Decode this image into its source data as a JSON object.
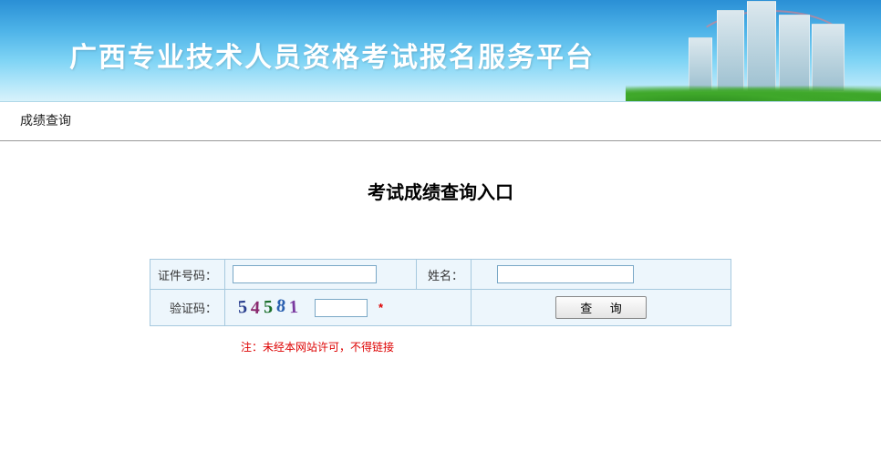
{
  "header": {
    "title": "广西专业技术人员资格考试报名服务平台"
  },
  "nav": {
    "label": "成绩查询"
  },
  "section": {
    "title": "考试成绩查询入口"
  },
  "form": {
    "id_label": "证件号码：",
    "id_value": "",
    "name_label": "姓名：",
    "name_value": "",
    "captcha_label": "验证码：",
    "captcha_chars": [
      "5",
      "4",
      "5",
      "8",
      "1"
    ],
    "captcha_value": "",
    "required_mark": "*",
    "query_button": "查 询"
  },
  "footnote": {
    "text": "注：未经本网站许可，不得链接"
  }
}
